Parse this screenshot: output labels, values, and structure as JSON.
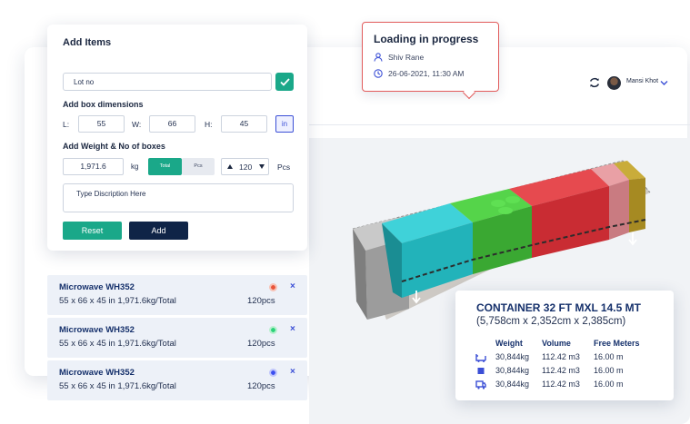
{
  "header": {
    "user_name": "Mansi Khot",
    "icons": [
      "refresh-icon",
      "avatar",
      "chevron-down-icon"
    ]
  },
  "add_items": {
    "title": "Add Items",
    "lot_placeholder": "Lot no",
    "box_dimensions_label": "Add box dimensions",
    "length_label": "L:",
    "length_value": "55",
    "width_label": "W:",
    "width_value": "66",
    "height_label": "H:",
    "height_value": "45",
    "unit_label": "in",
    "weight_section_label": "Add Weight & No of boxes",
    "weight_value": "1,971.6",
    "weight_unit": "kg",
    "mode_total": "Total",
    "mode_pcs": "Pcs",
    "box_count": "120",
    "box_count_unit": "Pcs",
    "description_placeholder": "Type Discription Here",
    "reset_label": "Reset",
    "add_label": "Add"
  },
  "items": [
    {
      "name": "Microwave WH352",
      "dims": "55 x 66 x 45 in 1,971.6kg/Total",
      "pcs": "120pcs",
      "color": "#e8543a",
      "close": "×"
    },
    {
      "name": "Microwave WH352",
      "dims": "55 x 66 x 45 in 1,971.6kg/Total",
      "pcs": "120pcs",
      "color": "#2bd27a",
      "close": "×"
    },
    {
      "name": "Microwave WH352",
      "dims": "55 x 66 x 45 in 1,971.6kg/Total",
      "pcs": "120pcs",
      "color": "#3c4ff0",
      "close": "×"
    }
  ],
  "tooltip": {
    "title": "Loading in progress",
    "user": "Shiv Rane",
    "datetime": "26-06-2021, 11:30 AM"
  },
  "container": {
    "title": "CONTAINER 32 FT MXL 14.5 MT",
    "dimensions": "(5,758cm x 2,352cm x 2,385cm)",
    "columns": [
      "Weight",
      "Volume",
      "Free Meters"
    ],
    "rows": [
      {
        "icon": "trolley-icon",
        "weight": "30,844kg",
        "volume": "112.42 m3",
        "free": "16.00 m"
      },
      {
        "icon": "box-icon",
        "weight": "30,844kg",
        "volume": "112.42 m3",
        "free": "16.00 m"
      },
      {
        "icon": "truck-icon",
        "weight": "30,844kg",
        "volume": "112.42 m3",
        "free": "16.00 m"
      }
    ]
  },
  "colors": {
    "accent_green": "#1aa889",
    "navy": "#0f2447",
    "blue": "#3b4fd6",
    "tooltip_border": "#e25b5b",
    "cargo": [
      "#30c6cd",
      "#43c039",
      "#d9343a",
      "#e07f86",
      "#b89a2a"
    ]
  }
}
